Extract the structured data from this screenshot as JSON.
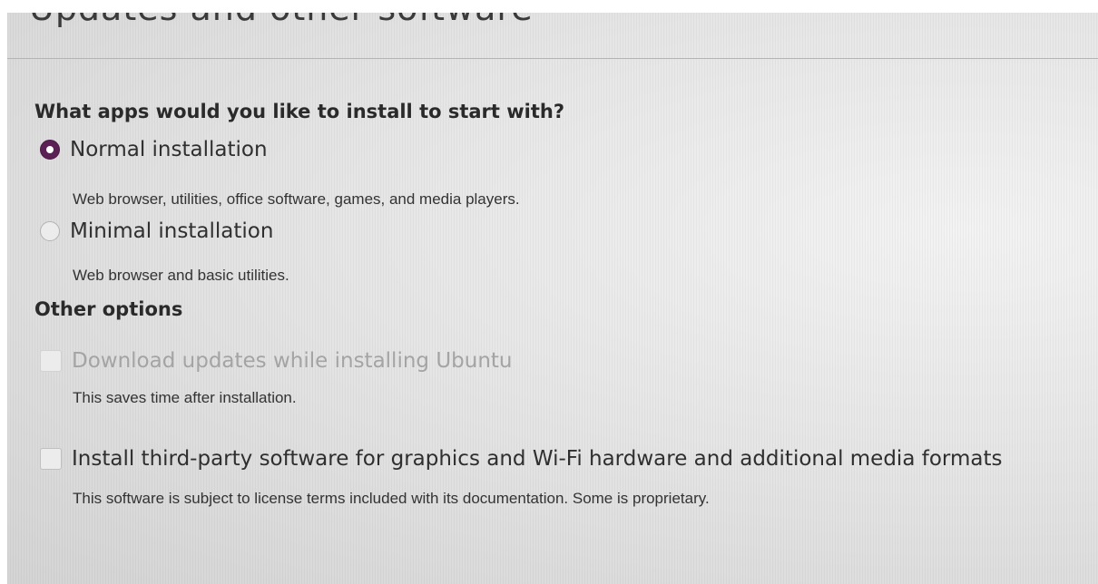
{
  "header": {
    "title": "Updates and other software"
  },
  "apps_section": {
    "heading": "What apps would you like to install to start with?",
    "options": [
      {
        "label": "Normal installation",
        "description": "Web browser, utilities, office software, games, and media players.",
        "selected": true
      },
      {
        "label": "Minimal installation",
        "description": "Web browser and basic utilities.",
        "selected": false
      }
    ]
  },
  "other_section": {
    "heading": "Other options",
    "options": [
      {
        "label": "Download updates while installing Ubuntu",
        "description": "This saves time after installation.",
        "checked": false,
        "enabled": false
      },
      {
        "label": "Install third-party software for graphics and Wi-Fi hardware and additional media formats",
        "description": "This software is subject to license terms included with its documentation. Some is proprietary.",
        "checked": false,
        "enabled": true
      }
    ]
  },
  "colors": {
    "radio_selected": "#5b2154",
    "text": "#2f2f2f",
    "disabled_text": "#a4a4a4"
  }
}
